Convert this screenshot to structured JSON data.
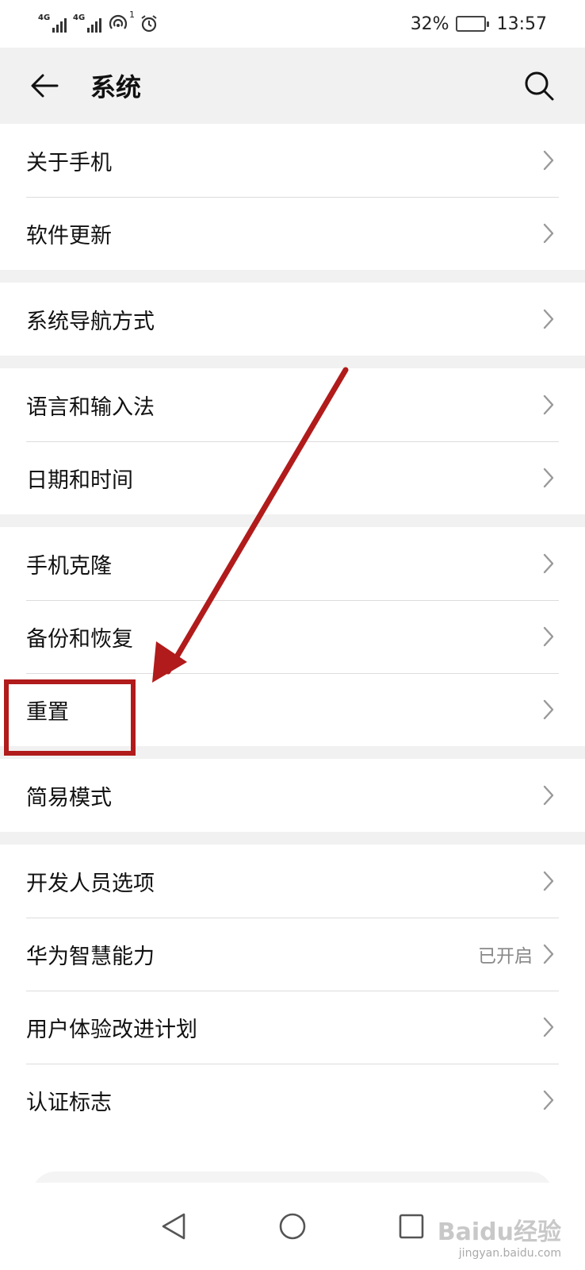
{
  "status_bar": {
    "network_1": "4G",
    "network_2": "4G",
    "notification_count": "1",
    "battery_percent": "32%",
    "battery_level": 0.32,
    "time": "13:57"
  },
  "header": {
    "title": "系统"
  },
  "groups": [
    {
      "items": [
        {
          "label": "关于手机"
        },
        {
          "label": "软件更新"
        }
      ]
    },
    {
      "items": [
        {
          "label": "系统导航方式"
        }
      ]
    },
    {
      "items": [
        {
          "label": "语言和输入法"
        },
        {
          "label": "日期和时间"
        }
      ]
    },
    {
      "items": [
        {
          "label": "手机克隆"
        },
        {
          "label": "备份和恢复"
        },
        {
          "label": "重置"
        }
      ]
    },
    {
      "items": [
        {
          "label": "简易模式"
        }
      ]
    },
    {
      "items": [
        {
          "label": "开发人员选项"
        },
        {
          "label": "华为智慧能力",
          "value": "已开启"
        },
        {
          "label": "用户体验改进计划"
        },
        {
          "label": "认证标志"
        }
      ]
    }
  ],
  "watermark": {
    "main": "Baidu经验",
    "sub": "jingyan.baidu.com"
  },
  "colors": {
    "header_bg": "#f1f1f1",
    "annotation": "#b11b1b"
  }
}
